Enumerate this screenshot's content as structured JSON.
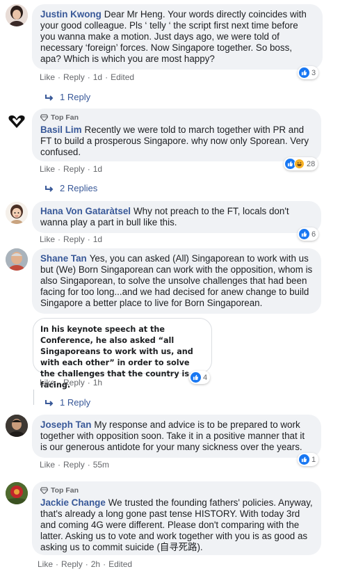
{
  "comments": [
    {
      "name": "Justin Kwong",
      "text": "Dear Mr Heng. Your words directly coincides with your good colleague. Pls ‘ telly ‘ the script first next time before you wanna make a motion. Just days ago, we were told of necessary ‘foreign’ forces. Now Singapore together. So boss, apa? Which is which you are most happy?",
      "like": "Like",
      "reply": "Reply",
      "time": "1d",
      "edited": "Edited",
      "reactions": "3",
      "replies": "1 Reply"
    },
    {
      "badge": "Top Fan",
      "name": "Basil Lim",
      "text": "Recently we were told to march together with PR and FT to build a prosperous Singapore. why now only Sporean. Very confused.",
      "like": "Like",
      "reply": "Reply",
      "time": "1d",
      "reactions": "28",
      "replies": "2 Replies"
    },
    {
      "name": "Hana Von Gataràtsel",
      "text": "Why not preach to the FT, locals don't wanna play a part in bull like this.",
      "like": "Like",
      "reply": "Reply",
      "time": "1d",
      "reactions": "6"
    },
    {
      "name": "Shane Tan",
      "text": "Yes, you can asked (All) Singaporean to work with us but (We) Born Singaporean can work with the opposition, whom is also Singaporean, to solve the unsolve challenges that had been facing for too long...and we had decised for anew change to build Singapore a better place to live for Born Singaporean.",
      "quote": "In his keynote speech at the Conference, he also asked “all Singaporeans to work with us, and with each other” in order to solve the challenges that the country is facing.",
      "like": "Like",
      "reply": "Reply",
      "time": "1h",
      "reactions": "4",
      "replies": "1 Reply"
    },
    {
      "name": "Joseph Tan",
      "text": "My response and advice is to be prepared to work together with opposition soon. Take it in a positive manner that it is our generous antidote for your many sickness over the years.",
      "like": "Like",
      "reply": "Reply",
      "time": "55m",
      "reactions": "1"
    },
    {
      "badge": "Top Fan",
      "name": "Jackie Change",
      "text": "We trusted the founding fathers' policies. Anyway, that's already a long gone past tense HISTORY. With today 3rd and coming 4G were different. Please don't comparing with the latter. Asking us to vote and work together with you is as good as asking us to commit suicide (自寻死路).",
      "like": "Like",
      "reply": "Reply",
      "time": "2h",
      "edited": "Edited"
    }
  ],
  "colors": {
    "link": "#385898",
    "bubble": "#f0f2f5",
    "like": "#1877f2",
    "meta": "#65676b"
  }
}
